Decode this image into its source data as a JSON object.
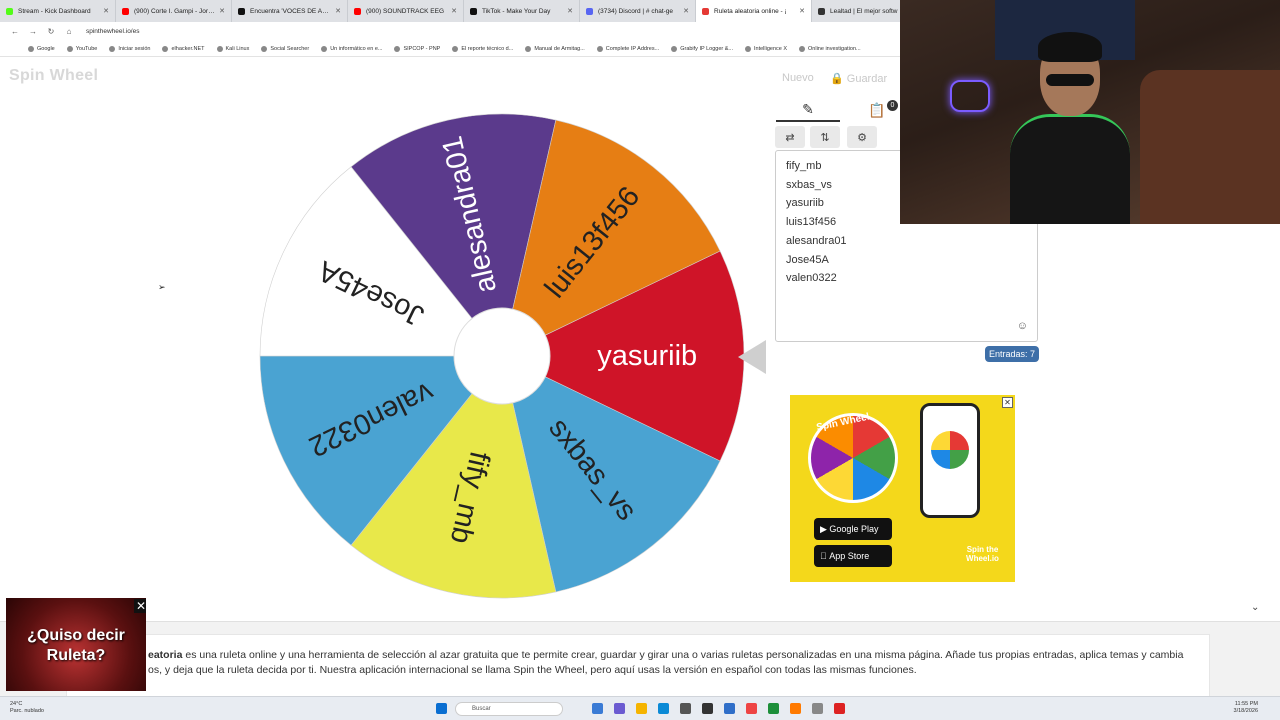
{
  "browser": {
    "tabs": [
      {
        "title": "Stream - Kick Dashboard",
        "color": "#53fc18",
        "active": false
      },
      {
        "title": "(900) Corte I. Gampi - Jordyn",
        "color": "#ff0000",
        "active": false
      },
      {
        "title": "Encuentra 'VOCES DE ANIMM",
        "color": "#111111",
        "active": false
      },
      {
        "title": "(900) SOUNDTRACK EEG",
        "color": "#ff0000",
        "active": false
      },
      {
        "title": "TikTok - Make Your Day",
        "color": "#111111",
        "active": false
      },
      {
        "title": "(3734) Discord | # chat-ge",
        "color": "#5865f2",
        "active": false
      },
      {
        "title": "Ruleta aleatoria online - ¡",
        "color": "#e53935",
        "active": true
      },
      {
        "title": "Lealtad | El mejor softw",
        "color": "#333333",
        "active": false
      }
    ],
    "url": "spinthewheel.io/es",
    "bookmarks": [
      "Google",
      "YouTube",
      "Iniciar sesión",
      "elhacker.NET",
      "Kali Linux",
      "Social Searcher",
      "Un informático en e...",
      "SIPCOP - PNP",
      "El reporte técnico d...",
      "Manual de Armitag...",
      "Complete IP Addres...",
      "Grabify IP Logger &...",
      "Intelligence X",
      "Online investigation..."
    ]
  },
  "header": {
    "logo": "Spin Wheel",
    "new_label": "Nuevo",
    "save_label": "Guardar"
  },
  "wheel": {
    "entries": [
      {
        "label": "yasuriib",
        "color": "#cf1428",
        "text_color": "#ffffff"
      },
      {
        "label": "sxbas_vs",
        "color": "#4aa3d2",
        "text_color": "#222222"
      },
      {
        "label": "fify_mb",
        "color": "#e8e84a",
        "text_color": "#222222"
      },
      {
        "label": "valen0322",
        "color": "#4aa3d2",
        "text_color": "#222222"
      },
      {
        "label": "Jose45A",
        "color": "#ffffff",
        "text_color": "#222222"
      },
      {
        "label": "alesandra01",
        "color": "#5b3a8c",
        "text_color": "#ffffff"
      },
      {
        "label": "luis13f456",
        "color": "#e67e14",
        "text_color": "#222222"
      }
    ]
  },
  "panel": {
    "results_badge": "0",
    "entries": [
      "fify_mb",
      "sxbas_vs",
      "yasuriib",
      "luis13f456",
      "alesandra01",
      "Jose45A",
      "valen0322"
    ],
    "count_label": "Entradas: 7"
  },
  "ad": {
    "title": "Spin Wheel",
    "google_play": "Google Play",
    "app_store": "App Store",
    "brand": "Spin the Wheel.io"
  },
  "promo": {
    "text_line1": "¿Quiso decir",
    "text_line2": "Ruleta?"
  },
  "description": {
    "lead": "eatoria",
    "text": " es una ruleta online y una herramienta de selección al azar gratuita que te permite crear, guardar y girar una o varias ruletas personalizadas en una misma página. Añade tus propias entradas, aplica temas y cambia",
    "text2": "os, y deja que la ruleta decida por ti. Nuestra aplicación internacional se llama Spin the Wheel, pero aquí usas la versión en español con todas las mismas funciones."
  },
  "taskbar": {
    "weather_temp": "24°C",
    "weather_desc": "Parc. nublado",
    "search_placeholder": "Buscar",
    "time": "11:55 PM",
    "date": "3/18/2026"
  }
}
